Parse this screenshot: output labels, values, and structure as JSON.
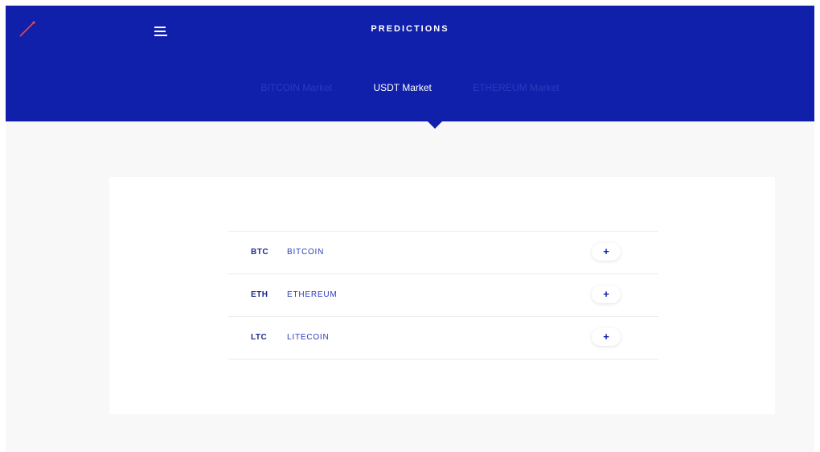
{
  "header": {
    "title": "PREDICTIONS",
    "tabs": [
      {
        "label": "BITCOIN Market",
        "active": false
      },
      {
        "label": "USDT Market",
        "active": true
      },
      {
        "label": "ETHEREUM Market",
        "active": false
      }
    ]
  },
  "markets": [
    {
      "symbol": "BTC",
      "name": "BITCOIN",
      "action": "+"
    },
    {
      "symbol": "ETH",
      "name": "ETHEREUM",
      "action": "+"
    },
    {
      "symbol": "LTC",
      "name": "LITECOIN",
      "action": "+"
    }
  ],
  "colors": {
    "brand": "#1020aa",
    "logo_accent": "#e5484d",
    "background": "#f8f8f8"
  },
  "icons": {
    "logo": "line-chart-logo-icon",
    "menu": "menu-icon"
  }
}
